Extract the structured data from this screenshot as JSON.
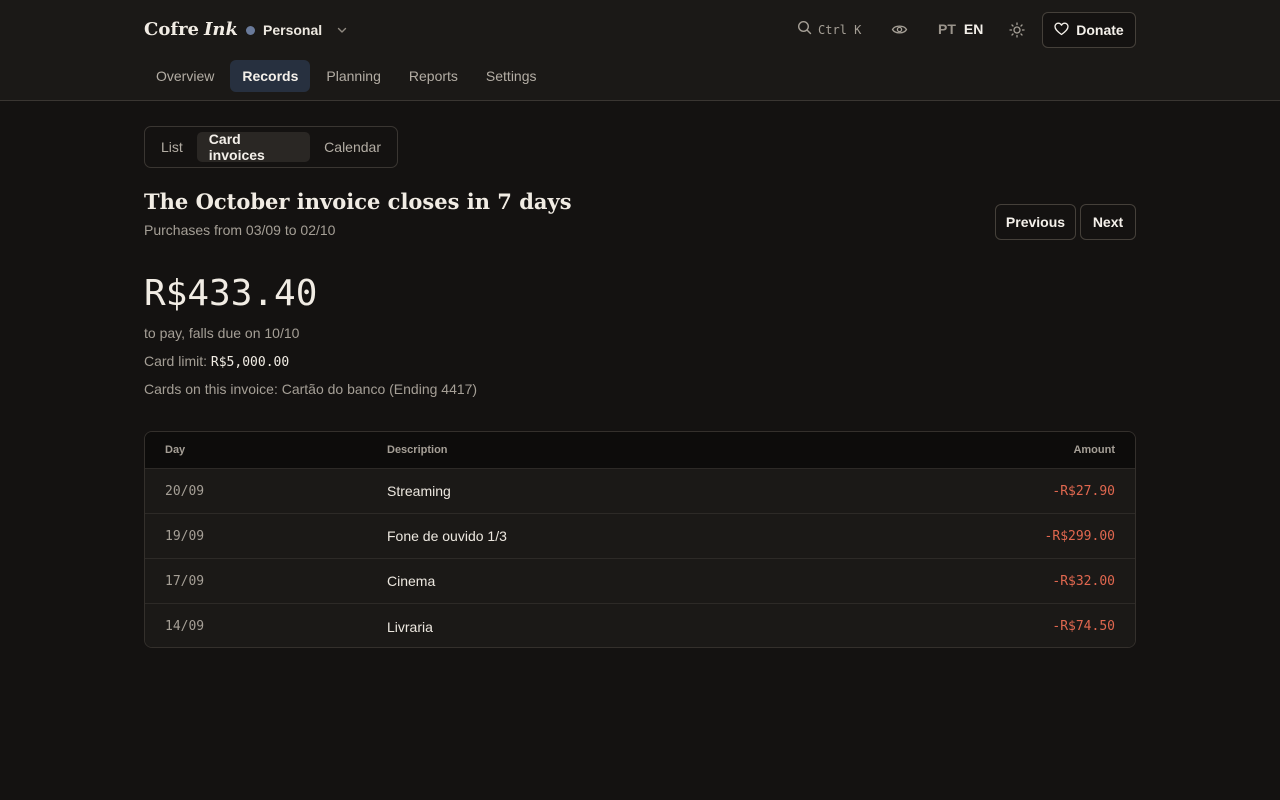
{
  "brand": {
    "name": "Cofre",
    "accent": "Ink"
  },
  "workspace": {
    "label": "Personal",
    "dot_color": "#6a7a9a"
  },
  "nav": {
    "tabs": [
      {
        "label": "Overview"
      },
      {
        "label": "Records"
      },
      {
        "label": "Planning"
      },
      {
        "label": "Reports"
      },
      {
        "label": "Settings"
      }
    ],
    "active": "Records"
  },
  "header": {
    "search_shortcut": "Ctrl K",
    "lang_pt": "PT",
    "lang_en": "EN",
    "active_lang": "EN",
    "donate_label": "Donate"
  },
  "subtabs": {
    "items": [
      {
        "label": "List"
      },
      {
        "label": "Card invoices"
      },
      {
        "label": "Calendar"
      }
    ],
    "active": "Card invoices"
  },
  "invoice": {
    "title": "The October invoice closes in 7 days",
    "subtitle": "Purchases from 03/09 to 02/10",
    "previous_label": "Previous",
    "next_label": "Next",
    "amount": "R$433.40",
    "due_text": "to pay, falls due on 10/10",
    "limit_label": "Card limit:",
    "limit_value": "R$5,000.00",
    "cards_text": "Cards on this invoice: Cartão do banco (Ending 4417)"
  },
  "table": {
    "headers": {
      "day": "Day",
      "description": "Description",
      "amount": "Amount"
    },
    "rows": [
      {
        "day": "20/09",
        "description": "Streaming",
        "amount": "-R$27.90"
      },
      {
        "day": "19/09",
        "description": "Fone de ouvido 1/3",
        "amount": "-R$299.00"
      },
      {
        "day": "17/09",
        "description": "Cinema",
        "amount": "-R$32.00"
      },
      {
        "day": "14/09",
        "description": "Livraria",
        "amount": "-R$74.50"
      }
    ]
  },
  "colors": {
    "negative_amount": "#e0674f",
    "active_nav_bg": "#27303f"
  },
  "icons": {
    "search": "search-icon",
    "visibility": "eye-icon",
    "theme": "sun-icon",
    "donate": "heart-icon",
    "workspace": "chevron-down-icon"
  }
}
